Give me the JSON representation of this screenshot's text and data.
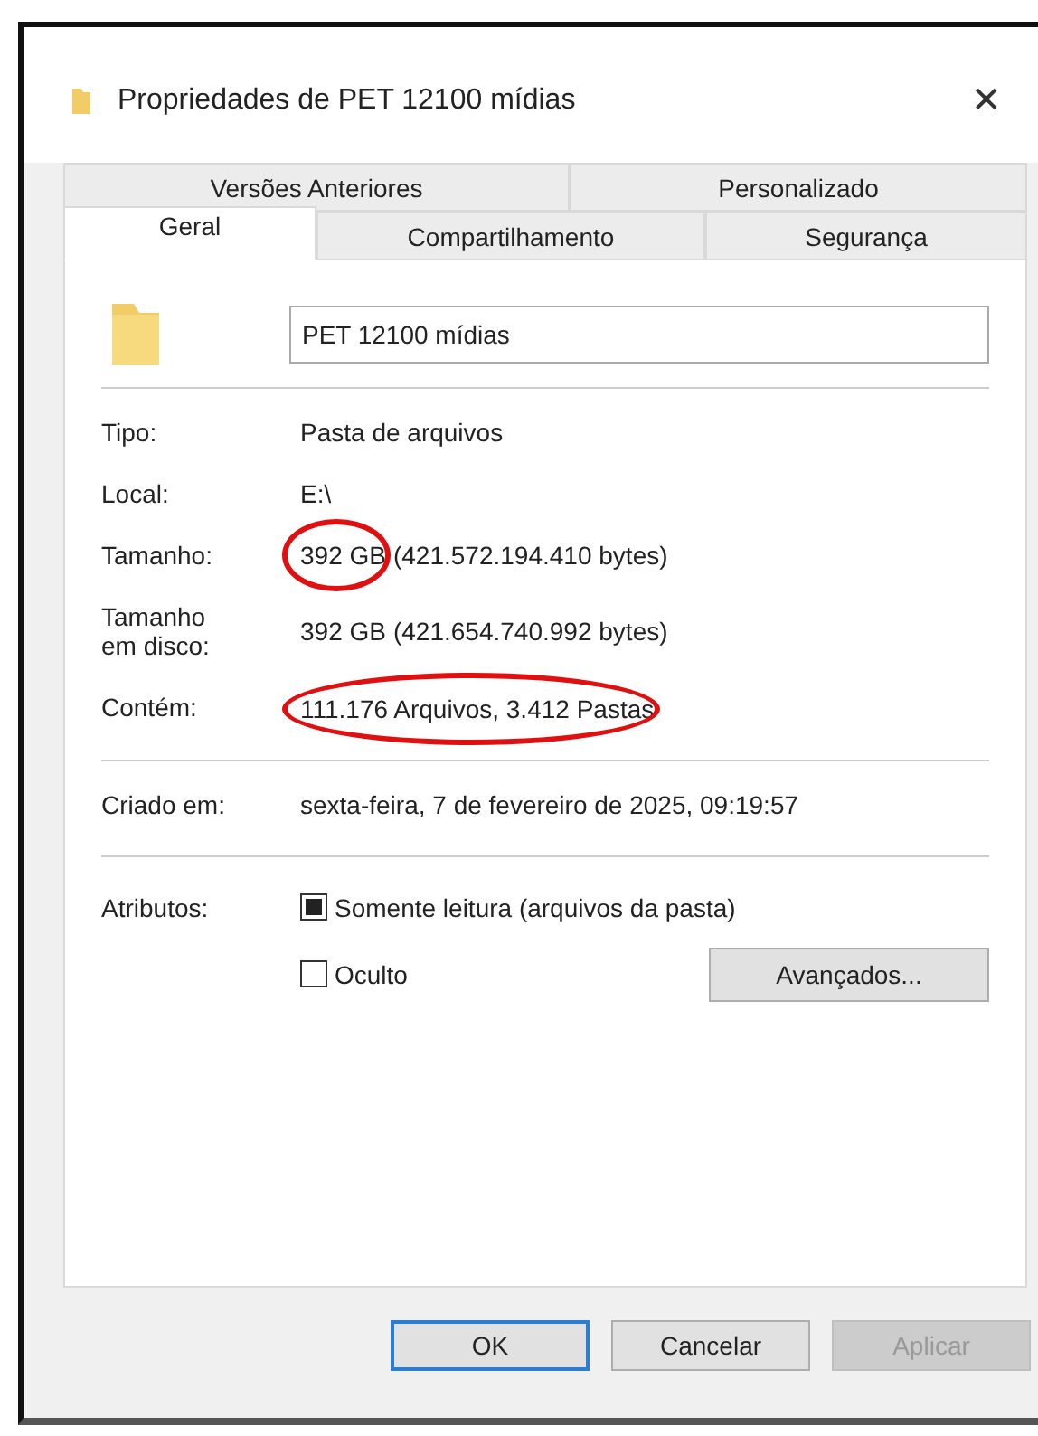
{
  "window": {
    "title": "Propriedades de PET 12100 mídias",
    "close": "✕"
  },
  "tab_rows": [
    [
      {
        "label": "Versões Anteriores",
        "selected": false
      },
      {
        "label": "Personalizado",
        "selected": false
      }
    ],
    [
      {
        "label": "Geral",
        "selected": true
      },
      {
        "label": "Compartilhamento",
        "selected": false
      },
      {
        "label": "Segurança",
        "selected": false
      }
    ]
  ],
  "name_field": {
    "value": "PET 12100 mídias"
  },
  "groups": [
    [
      {
        "label": "Tipo:",
        "value": "Pasta de arquivos",
        "circled": false
      },
      {
        "label": "Local:",
        "value": "E:\\",
        "circled": false
      },
      {
        "label": "Tamanho:",
        "value": "392 GB",
        "detail": "(421.572.194.410 bytes)",
        "circled": true
      },
      {
        "label": "Tamanho em disco:",
        "value": "392 GB",
        "detail": "(421.654.740.992 bytes)",
        "circled": false
      },
      {
        "label": "Contém:",
        "value": "111.176 Arquivos, 3.412 Pastas",
        "circled": true
      }
    ],
    [
      {
        "label": "Criado em:",
        "value": "sexta-feira, 7 de fevereiro de 2025, 09:19:57",
        "circled": false
      }
    ]
  ],
  "attributes": {
    "label": "Atributos:",
    "items": [
      {
        "label": "Somente leitura (arquivos da pasta)",
        "checked": false,
        "indeterminate": true
      },
      {
        "label": "Oculto",
        "checked": false,
        "indeterminate": false
      }
    ],
    "advanced_button": "Avançados..."
  },
  "buttons": [
    {
      "label": "OK",
      "default": true,
      "disabled": false
    },
    {
      "label": "Cancelar",
      "default": false,
      "disabled": false
    },
    {
      "label": "Aplicar",
      "default": false,
      "disabled": true
    }
  ]
}
